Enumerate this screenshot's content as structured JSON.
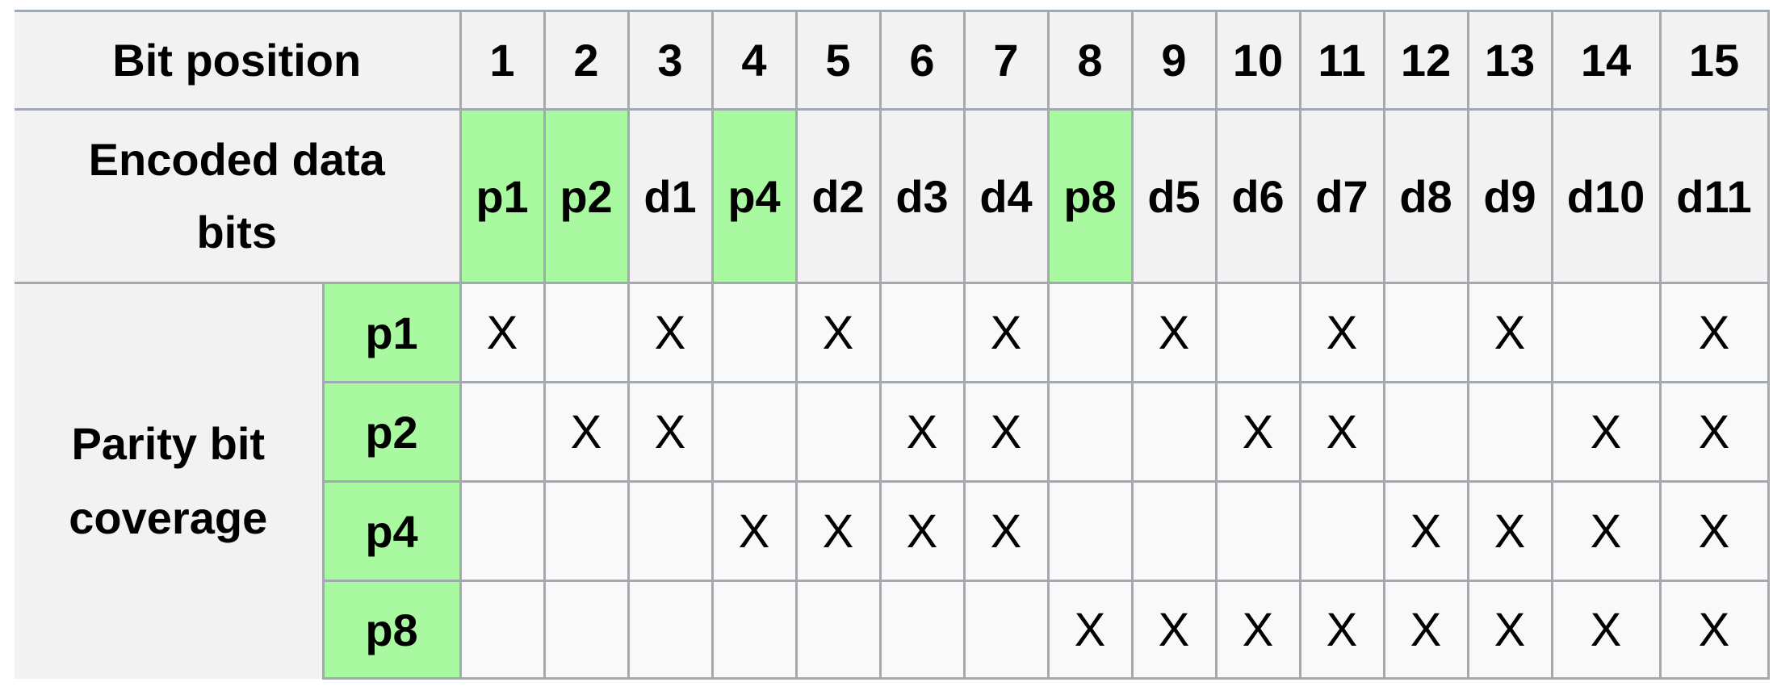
{
  "table": {
    "bit_position_label": "Bit position",
    "encoded_label": "Encoded data bits",
    "coverage_label": "Parity bit coverage",
    "positions": [
      "1",
      "2",
      "3",
      "4",
      "5",
      "6",
      "7",
      "8",
      "9",
      "10",
      "11",
      "12",
      "13",
      "14",
      "15"
    ],
    "encoded": [
      {
        "label": "p1",
        "parity": true
      },
      {
        "label": "p2",
        "parity": true
      },
      {
        "label": "d1",
        "parity": false
      },
      {
        "label": "p4",
        "parity": true
      },
      {
        "label": "d2",
        "parity": false
      },
      {
        "label": "d3",
        "parity": false
      },
      {
        "label": "d4",
        "parity": false
      },
      {
        "label": "p8",
        "parity": true
      },
      {
        "label": "d5",
        "parity": false
      },
      {
        "label": "d6",
        "parity": false
      },
      {
        "label": "d7",
        "parity": false
      },
      {
        "label": "d8",
        "parity": false
      },
      {
        "label": "d9",
        "parity": false
      },
      {
        "label": "d10",
        "parity": false
      },
      {
        "label": "d11",
        "parity": false
      }
    ],
    "coverage": [
      {
        "bit": "p1",
        "cells": [
          "X",
          "",
          "X",
          "",
          "X",
          "",
          "X",
          "",
          "X",
          "",
          "X",
          "",
          "X",
          "",
          "X"
        ]
      },
      {
        "bit": "p2",
        "cells": [
          "",
          "X",
          "X",
          "",
          "",
          "X",
          "X",
          "",
          "",
          "X",
          "X",
          "",
          "",
          "X",
          "X"
        ]
      },
      {
        "bit": "p4",
        "cells": [
          "",
          "",
          "",
          "X",
          "X",
          "X",
          "X",
          "",
          "",
          "",
          "",
          "X",
          "X",
          "X",
          "X"
        ]
      },
      {
        "bit": "p8",
        "cells": [
          "",
          "",
          "",
          "",
          "",
          "",
          "",
          "X",
          "X",
          "X",
          "X",
          "X",
          "X",
          "X",
          "X"
        ]
      }
    ],
    "colors": {
      "parity_highlight": "#a8f9a0",
      "header_bg": "#f2f2f2",
      "cell_bg": "#f9f9f9",
      "border": "#a2a9b1"
    }
  }
}
